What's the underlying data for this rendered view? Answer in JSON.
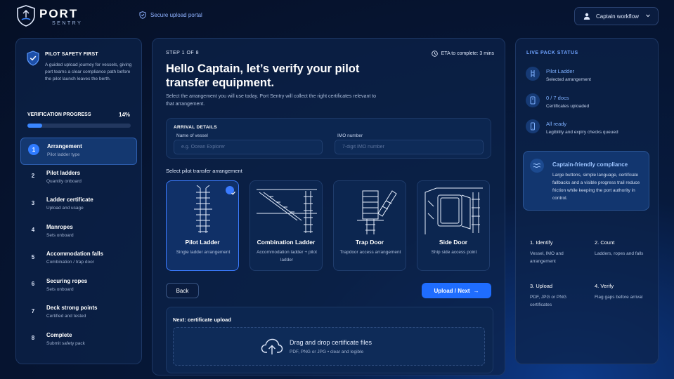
{
  "brand": {
    "name": "PORT",
    "sub": "SENTRY"
  },
  "header": {
    "secure_label": "Secure upload portal",
    "workflow_label": "Captain workflow"
  },
  "sidebar": {
    "safety_title": "PILOT SAFETY FIRST",
    "safety_desc": "A guided upload journey for vessels, giving port teams a clear compliance path before the pilot launch leaves the berth.",
    "progress_label": "VERIFICATION PROGRESS",
    "progress_pct": "14%",
    "progress_value": 0.14,
    "steps": [
      {
        "num": "1",
        "title": "Arrangement",
        "sub": "Pilot ladder type"
      },
      {
        "num": "2",
        "title": "Pilot ladders",
        "sub": "Quantity onboard"
      },
      {
        "num": "3",
        "title": "Ladder certificate",
        "sub": "Upload and usage"
      },
      {
        "num": "4",
        "title": "Manropes",
        "sub": "Sets onboard"
      },
      {
        "num": "5",
        "title": "Accommodation falls",
        "sub": "Combination / trap door"
      },
      {
        "num": "6",
        "title": "Securing ropes",
        "sub": "Sets onboard"
      },
      {
        "num": "7",
        "title": "Deck strong points",
        "sub": "Certified and tested"
      },
      {
        "num": "8",
        "title": "Complete",
        "sub": "Submit safety pack"
      }
    ]
  },
  "main": {
    "step_label": "STEP 1 OF 8",
    "eta": "ETA to complete: 3 mins",
    "title": "Hello Captain, let’s verify your pilot transfer equipment.",
    "subtitle": "Select the arrangement you will use today. Port Sentry will collect the right certificates relevant to that arrangement.",
    "arrival": {
      "title": "ARRIVAL DETAILS",
      "vessel_label": "Name of vessel",
      "vessel_placeholder": "e.g. Ocean Explorer",
      "imo_label": "IMO number",
      "imo_placeholder": "7-digit IMO number"
    },
    "select_label": "Select pilot transfer arrangement",
    "cards": [
      {
        "title": "Pilot Ladder",
        "sub": "Single ladder arrangement",
        "selected": true
      },
      {
        "title": "Combination Ladder",
        "sub": "Accommodation ladder + pilot ladder",
        "selected": false
      },
      {
        "title": "Trap Door",
        "sub": "Trapdoor access arrangement",
        "selected": false
      },
      {
        "title": "Side Door",
        "sub": "Ship side access point",
        "selected": false
      }
    ],
    "back_label": "Back",
    "next_label": "Upload / Next",
    "next_arrow": "→",
    "upload": {
      "title": "Next: certificate upload",
      "drop_title": "Drag and drop certificate files",
      "drop_sub": "PDF, PNG or JPG • clear and legible"
    }
  },
  "live": {
    "title": "LIVE PACK STATUS",
    "items": [
      {
        "title": "Pilot Ladder",
        "sub": "Selected arrangement",
        "icon": "ladder-icon"
      },
      {
        "title": "0 / 7 docs",
        "sub": "Certificates uploaded",
        "icon": "document-icon"
      },
      {
        "title": "All ready",
        "sub": "Legibility and expiry checks queued",
        "icon": "phone-icon"
      }
    ],
    "compliance_title": "Captain-friendly compliance",
    "compliance_desc": "Large buttons, simple language, certificate fallbacks and a visible progress trail reduce friction while keeping the port authority in control.",
    "guide": [
      {
        "title": "1.   Identify",
        "desc": "Vessel, IMO and arrangement"
      },
      {
        "title": "2.   Count",
        "desc": "Ladders, ropes and falls"
      },
      {
        "title": "3.   Upload",
        "desc": "PDF, JPG or PNG certificates"
      },
      {
        "title": "4.   Verify",
        "desc": "Flag gaps before arrival"
      }
    ]
  },
  "colors": {
    "accent": "#1f6dff",
    "background": "#061430",
    "panel": "#0c224a",
    "highlight": "#7eb0ff"
  }
}
